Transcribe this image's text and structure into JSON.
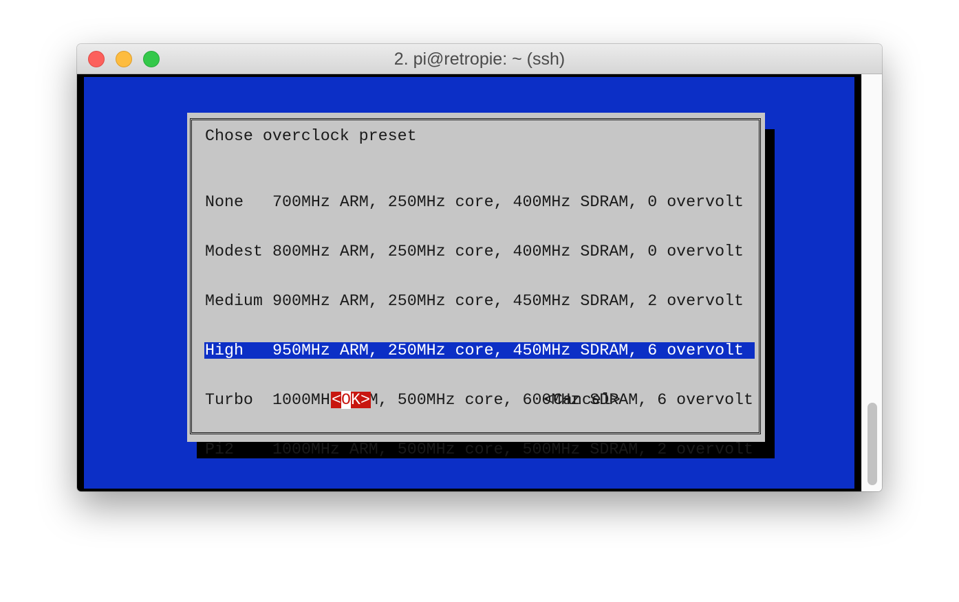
{
  "window": {
    "title": "2. pi@retropie: ~ (ssh)"
  },
  "dialog": {
    "prompt": "Chose overclock preset",
    "items": [
      {
        "tag": "None",
        "description": "700MHz ARM, 250MHz core, 400MHz SDRAM, 0 overvolt"
      },
      {
        "tag": "Modest",
        "description": "800MHz ARM, 250MHz core, 400MHz SDRAM, 0 overvolt"
      },
      {
        "tag": "Medium",
        "description": "900MHz ARM, 250MHz core, 450MHz SDRAM, 2 overvolt"
      },
      {
        "tag": "High",
        "description": "950MHz ARM, 250MHz core, 450MHz SDRAM, 6 overvolt"
      },
      {
        "tag": "Turbo",
        "description": "1000MHz ARM, 500MHz core, 600MHz SDRAM, 6 overvolt"
      },
      {
        "tag": "Pi2",
        "description": "1000MHz ARM, 500MHz core, 500MHz SDRAM, 2 overvolt"
      }
    ],
    "selected_index": 3,
    "ok_button": {
      "left": "<",
      "hotkey": "O",
      "rest": "K",
      "right": ">"
    },
    "cancel_button": {
      "label": "<Cancel>"
    }
  },
  "colors": {
    "terminal_background": "#0c2fc6",
    "dialog_background": "#c6c6c6",
    "selection": "#0c2fc6",
    "ok_button": "#c8160f"
  }
}
